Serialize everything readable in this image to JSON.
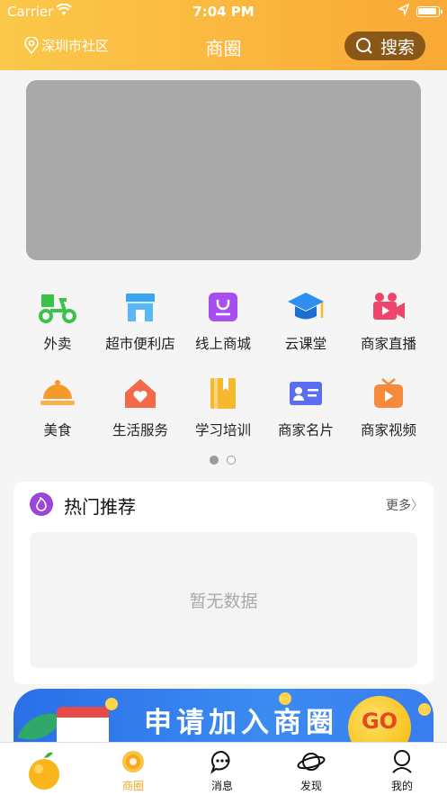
{
  "status_bar": {
    "carrier": "Carrier",
    "time": "7:04 PM"
  },
  "nav": {
    "location": "深圳市社区",
    "title": "商圈",
    "search_label": "搜索"
  },
  "categories": [
    {
      "label": "外卖",
      "icon": "scooter-icon",
      "color": "#3cc24a"
    },
    {
      "label": "超市便利店",
      "icon": "store-icon",
      "color": "#3aa5f2"
    },
    {
      "label": "线上商城",
      "icon": "shopping-bag-icon",
      "color": "#a74ef0"
    },
    {
      "label": "云课堂",
      "icon": "graduation-cap-icon",
      "color": "#2f8ef0"
    },
    {
      "label": "商家直播",
      "icon": "video-camera-icon",
      "color": "#f0456a"
    },
    {
      "label": "美食",
      "icon": "food-cloche-icon",
      "color": "#f59a2a"
    },
    {
      "label": "生活服务",
      "icon": "home-heart-icon",
      "color": "#f26a4a"
    },
    {
      "label": "学习培训",
      "icon": "book-icon",
      "color": "#f5b82e"
    },
    {
      "label": "商家名片",
      "icon": "business-card-icon",
      "color": "#5a6ef0"
    },
    {
      "label": "商家视频",
      "icon": "tv-icon",
      "color": "#f58a3a"
    }
  ],
  "pager": {
    "pages": 2,
    "current": 1
  },
  "hot": {
    "title": "热门推荐",
    "more": "更多",
    "empty": "暂无数据"
  },
  "promo": {
    "text": "申请加入商圈",
    "go": "GO"
  },
  "tabs": [
    {
      "label": "",
      "icon": "orange-logo-icon"
    },
    {
      "label": "商圈",
      "icon": "business-circle-icon",
      "active": true
    },
    {
      "label": "消息",
      "icon": "message-icon"
    },
    {
      "label": "发现",
      "icon": "planet-icon"
    },
    {
      "label": "我的",
      "icon": "profile-icon"
    }
  ],
  "colors": {
    "header_start": "#fbc84a",
    "header_end": "#f9a935",
    "accent": "#f5a623",
    "search_bg": "#8a5718"
  }
}
